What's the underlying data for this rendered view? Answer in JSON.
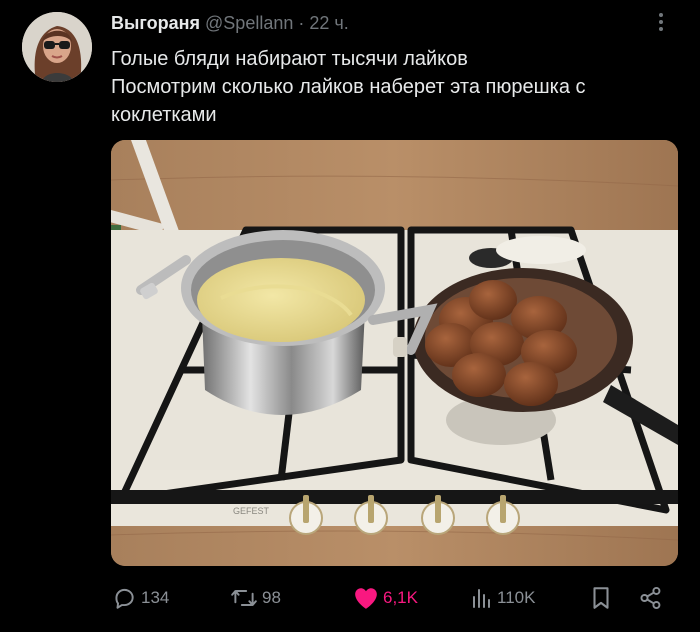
{
  "tweet": {
    "author_name": "Выгораня",
    "handle": "@Spellann",
    "separator": "·",
    "time": "22 ч.",
    "text_lines": [
      "Голые бляди набирают тысячи лайков",
      "Посмотрим сколько лайков наберет эта пюрешка с",
      "коклетками"
    ],
    "media": {
      "stove_brand": "GEFEST"
    }
  },
  "actions": {
    "replies": "134",
    "reposts": "98",
    "likes": "6,1K",
    "views": "110K"
  },
  "colors": {
    "background": "#000000",
    "text": "#e7e9ea",
    "muted": "#71767b",
    "like": "#f91880"
  }
}
